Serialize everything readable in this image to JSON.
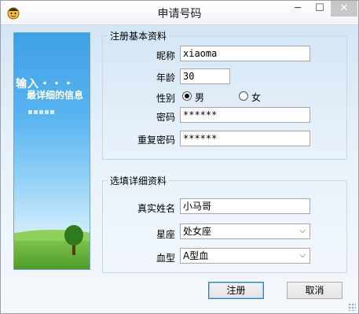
{
  "window": {
    "title": "申请号码",
    "minimize_glyph": "─",
    "maximize_glyph": "☐",
    "close_glyph": "✕"
  },
  "side_panel": {
    "line1": "输入・・・",
    "line2": "最详细的信息"
  },
  "basic_group": {
    "legend": "注册基本资料",
    "nickname_label": "昵称",
    "nickname_value": "xiaoma",
    "age_label": "年龄",
    "age_value": "30",
    "gender_label": "性别",
    "gender_options": [
      "男",
      "女"
    ],
    "gender_selected": "男",
    "password_label": "密码",
    "password_value": "******",
    "confirm_password_label": "重复密码",
    "confirm_password_value": "******"
  },
  "detail_group": {
    "legend": "选填详细资料",
    "real_name_label": "真实姓名",
    "real_name_value": "小马哥",
    "zodiac_label": "星座",
    "zodiac_value": "处女座",
    "blood_type_label": "血型",
    "blood_type_value": "A型血"
  },
  "buttons": {
    "register": "注册",
    "cancel": "取消"
  },
  "icons": {
    "app": "app-face-icon",
    "dropdown": "chevron-down-icon"
  }
}
